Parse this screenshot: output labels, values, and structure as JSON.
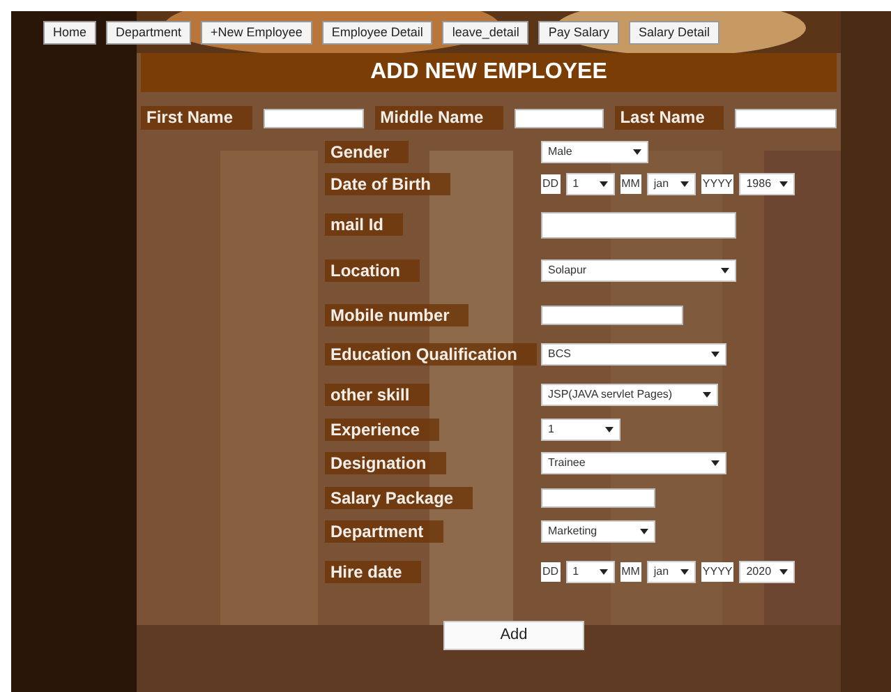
{
  "nav": [
    {
      "label": "Home"
    },
    {
      "label": "Department"
    },
    {
      "label": "+New Employee"
    },
    {
      "label": "Employee Detail"
    },
    {
      "label": "leave_detail"
    },
    {
      "label": "Pay Salary"
    },
    {
      "label": "Salary Detail"
    }
  ],
  "title": "ADD NEW EMPLOYEE",
  "name_fields": [
    {
      "label": "First Name"
    },
    {
      "label": "Middle Name"
    },
    {
      "label": "Last Name"
    }
  ],
  "fields": [
    {
      "label": "Gender",
      "kind": "select",
      "value": "Male"
    },
    {
      "label": "Date of Birth",
      "kind": "date",
      "parts": [
        {
          "kind": "tag",
          "text": "DD"
        },
        {
          "kind": "select",
          "value": "1"
        },
        {
          "kind": "tag",
          "text": "MM"
        },
        {
          "kind": "select",
          "value": "jan"
        },
        {
          "kind": "tag",
          "text": "YYYY"
        },
        {
          "kind": "select",
          "value": "1986"
        }
      ]
    },
    {
      "label": "mail Id",
      "kind": "input"
    },
    {
      "label": "Location",
      "kind": "select",
      "value": "Solapur"
    },
    {
      "label": "Mobile number",
      "kind": "input"
    },
    {
      "label": "Education Qualification",
      "kind": "select",
      "value": "BCS"
    },
    {
      "label": "other skill",
      "kind": "select",
      "value": "JSP(JAVA servlet Pages)"
    },
    {
      "label": "Experience",
      "kind": "select",
      "value": "1"
    },
    {
      "label": "Designation",
      "kind": "select",
      "value": "Trainee"
    },
    {
      "label": "Salary Package",
      "kind": "input"
    },
    {
      "label": "Department",
      "kind": "select",
      "value": "Marketing"
    },
    {
      "label": "Hire date",
      "kind": "date",
      "parts": [
        {
          "kind": "tag",
          "text": "DD"
        },
        {
          "kind": "select",
          "value": "1"
        },
        {
          "kind": "tag",
          "text": "MM"
        },
        {
          "kind": "select",
          "value": "jan"
        },
        {
          "kind": "tag",
          "text": "YYYY"
        },
        {
          "kind": "select",
          "value": "2020"
        }
      ]
    }
  ],
  "submit": "Add"
}
